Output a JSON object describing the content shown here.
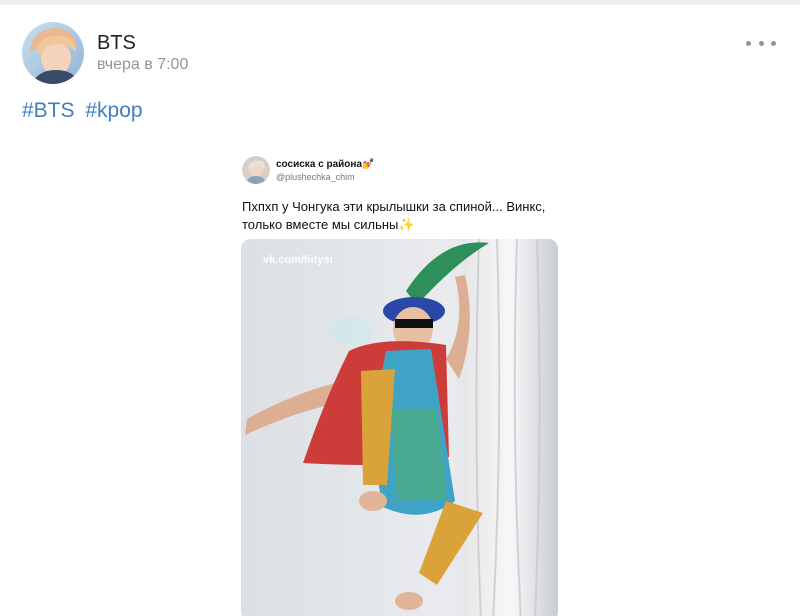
{
  "post": {
    "author": "BTS",
    "time": "вчера в 7:00",
    "hashtags": [
      "#BTS",
      "#kpop"
    ]
  },
  "tweet": {
    "name": "сосиска с района",
    "name_emoji": "💅",
    "handle": "@plushechka_chim",
    "text": "Пхпхп у Чонгука эти крылышки за спиной... Винкс, только вместе мы сильны",
    "text_emoji": "✨",
    "watermark": "vk.com/bitysi"
  },
  "icons": {
    "more": "more-horizontal-icon"
  },
  "colors": {
    "page_bg": "#edeef0",
    "card_bg": "#ffffff",
    "link": "#3f7ec1",
    "muted": "#939393"
  }
}
